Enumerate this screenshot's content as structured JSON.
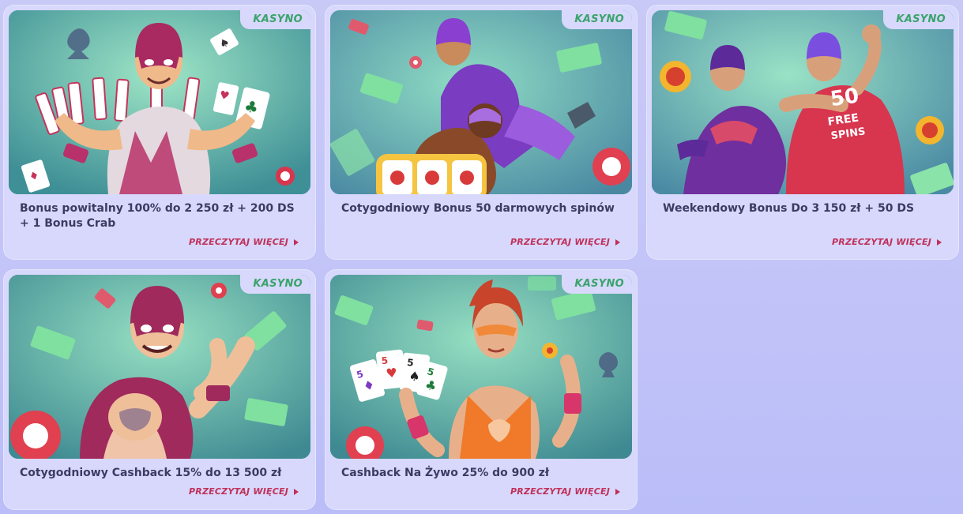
{
  "colors": {
    "page_bg": "#c3c4f8",
    "card_bg": "#d7d8fb",
    "tag_text": "#3aa36b",
    "title_text": "#3d3a63",
    "link_text": "#c0305a"
  },
  "cards": [
    {
      "tag": "KASYNO",
      "title": "Bonus powitalny 100% do 2 250 zł + 200 DS + 1 Bonus Crab",
      "link": "PRZECZYTAJ WIĘCEJ",
      "image": "wrestler-with-playing-cards"
    },
    {
      "tag": "KASYNO",
      "title": "Cotygodniowy Bonus 50 darmowych spinów",
      "link": "PRZECZYTAJ WIĘCEJ",
      "image": "wrestlers-grappling-slot-reels"
    },
    {
      "tag": "KASYNO",
      "title": "Weekendowy Bonus Do 3 150 zł + 50 DS",
      "link": "PRZECZYTAJ WIĘCEJ",
      "image": "wrestlers-fighting-free-spins",
      "image_text_line1": "50",
      "image_text_line2": "FREE",
      "image_text_line3": "SPINS"
    },
    {
      "tag": "KASYNO",
      "title": "Cotygodniowy Cashback 15% do 13 500 zł",
      "link": "PRZECZYTAJ WIĘCEJ",
      "image": "wrestler-flexing"
    },
    {
      "tag": "KASYNO",
      "title": "Cashback Na Żywo 25% do 900 zł",
      "link": "PRZECZYTAJ WIĘCEJ",
      "image": "female-wrestler-with-cards",
      "card_values": [
        "5",
        "5",
        "5",
        "5"
      ]
    }
  ]
}
